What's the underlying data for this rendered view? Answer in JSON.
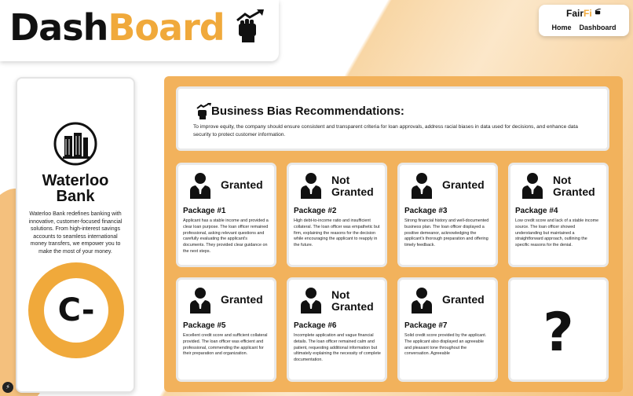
{
  "header": {
    "logo_part1": "Dash",
    "logo_part2": "Board"
  },
  "nav": {
    "brand_part1": "Fair",
    "brand_part2": "Fi",
    "links": [
      "Home",
      "Dashboard"
    ]
  },
  "bank": {
    "name_line1": "Waterloo",
    "name_line2": "Bank",
    "description": "Waterloo Bank redefines banking with innovative, customer-focused financial solutions. From high-interest savings accounts to seamless international money transfers, we empower you to make the most of your money.",
    "grade": "C-"
  },
  "recommendations": {
    "title": "Business Bias Recommendations:",
    "text": "To improve equity, the company should ensure consistent and transparent criteria for loan approvals, address racial biases in data used for decisions, and enhance data security to protect customer information."
  },
  "packages": [
    {
      "status_line1": "Granted",
      "status_line2": "",
      "title": "Package #1",
      "desc": "Applicant has a stable income and provided a clear loan purpose. The loan officer remained professional, asking relevant questions and carefully evaluating the applicant's documents. They provided clear guidance on the next steps."
    },
    {
      "status_line1": "Not",
      "status_line2": "Granted",
      "title": "Package #2",
      "desc": "High debt-to-income ratio and insufficient collateral. The loan officer was empathetic but firm, explaining the reasons for the decision while encouraging the applicant to reapply in the future."
    },
    {
      "status_line1": "Granted",
      "status_line2": "",
      "title": "Package #3",
      "desc": "Strong financial history and well-documented business plan. The loan officer displayed a positive demeanor, acknowledging the applicant's thorough preparation and offering timely feedback."
    },
    {
      "status_line1": "Not",
      "status_line2": "Granted",
      "title": "Package #4",
      "desc": "Low credit score and lack of a stable income source. The loan officer showed understanding but maintained a straightforward approach, outlining the specific reasons for the denial."
    },
    {
      "status_line1": "Granted",
      "status_line2": "",
      "title": "Package #5",
      "desc": "Excellent credit score and sufficient collateral provided. The loan officer was efficient and professional, commending the applicant for their preparation and organization."
    },
    {
      "status_line1": "Not",
      "status_line2": "Granted",
      "title": "Package #6",
      "desc": "Incomplete application and vague financial details. The loan officer remained calm and patient, requesting additional information but ultimately explaining the necessity of complete documentation."
    },
    {
      "status_line1": "Granted",
      "status_line2": "",
      "title": "Package #7",
      "desc": "Solid credit score provided by the applicant. The applicant also displayed an agreeable and pleasant tone throughout the conversation. Agreeable"
    }
  ],
  "unknown_card": {
    "symbol": "?"
  },
  "colors": {
    "accent": "#f0a93b",
    "panel": "#f2b25c",
    "text": "#111111"
  }
}
